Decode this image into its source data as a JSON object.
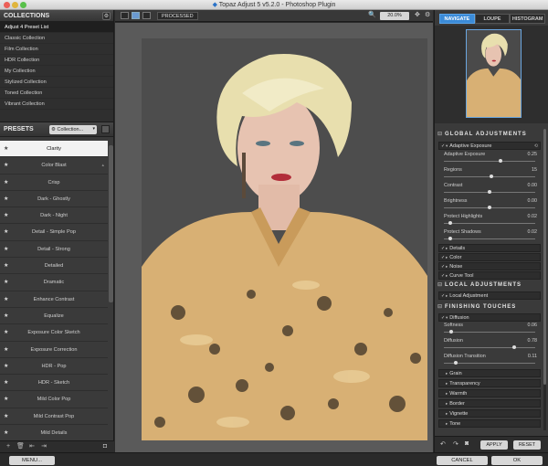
{
  "window": {
    "title": "Topaz Adjust 5 v5.2.0 - Photoshop Plugin"
  },
  "collections": {
    "header": "COLLECTIONS",
    "items": [
      "Adjust 4 Preset List",
      "Classic Collection",
      "Film Collection",
      "HDR Collection",
      "My Collection",
      "Stylized Collection",
      "Toned Collection",
      "Vibrant Collection"
    ]
  },
  "presets": {
    "header": "PRESETS",
    "collection_dropdown": "Collection...",
    "items": [
      "Clarity",
      "Color Blast",
      "Crisp",
      "Dark - Ghostly",
      "Dark - Night",
      "Detail - Simple Pop",
      "Detail - Strong",
      "Detailed",
      "Dramatic",
      "Enhance Contrast",
      "Equalize",
      "Exposure Color Sketch",
      "Exposure Correction",
      "HDR - Pop",
      "HDR - Sketch",
      "Mild Color Pop",
      "Mild Contrast Pop",
      "Mild Details"
    ],
    "selected": "Clarity"
  },
  "toolbar": {
    "processed_label": "PROCESSED",
    "zoom": "20.0%"
  },
  "right": {
    "tabs": [
      "NAVIGATE",
      "LOUPE",
      "HISTOGRAM"
    ],
    "global_header": "GLOBAL ADJUSTMENTS",
    "adaptive_exposure": "Adaptive Exposure",
    "sliders": [
      {
        "label": "Adaptive Exposure",
        "value": "0.25",
        "pos": 0.62
      },
      {
        "label": "Regions",
        "value": "15",
        "pos": 0.52
      },
      {
        "label": "Contrast",
        "value": "0.00",
        "pos": 0.5
      },
      {
        "label": "Brightness",
        "value": "0.00",
        "pos": 0.5
      },
      {
        "label": "Protect Highlights",
        "value": "0.02",
        "pos": 0.05
      },
      {
        "label": "Protect Shadows",
        "value": "0.02",
        "pos": 0.05
      }
    ],
    "groups": [
      "Details",
      "Color",
      "Noise",
      "Curve Tool"
    ],
    "local_header": "LOCAL ADJUSTMENTS",
    "local_adjustment": "Local Adjustment",
    "finishing_header": "FINISHING TOUCHES",
    "diffusion": "Diffusion",
    "diffusion_sliders": [
      {
        "label": "Softness",
        "value": "0.06",
        "pos": 0.06
      },
      {
        "label": "Diffusion",
        "value": "0.78",
        "pos": 0.78
      },
      {
        "label": "Diffusion Transition",
        "value": "0.11",
        "pos": 0.11
      }
    ],
    "finishing_groups": [
      "Grain",
      "Transparency",
      "Warmth",
      "Border",
      "Vignette",
      "Tone"
    ],
    "apply_label": "APPLY",
    "reset_label": "RESET"
  },
  "bottom": {
    "menu_label": "MENU...",
    "cancel_label": "CANCEL",
    "ok_label": "OK"
  },
  "colors": {
    "accent": "#3b8bd8",
    "panel": "#3a3a3a",
    "canvas": "#5a5a5a"
  }
}
